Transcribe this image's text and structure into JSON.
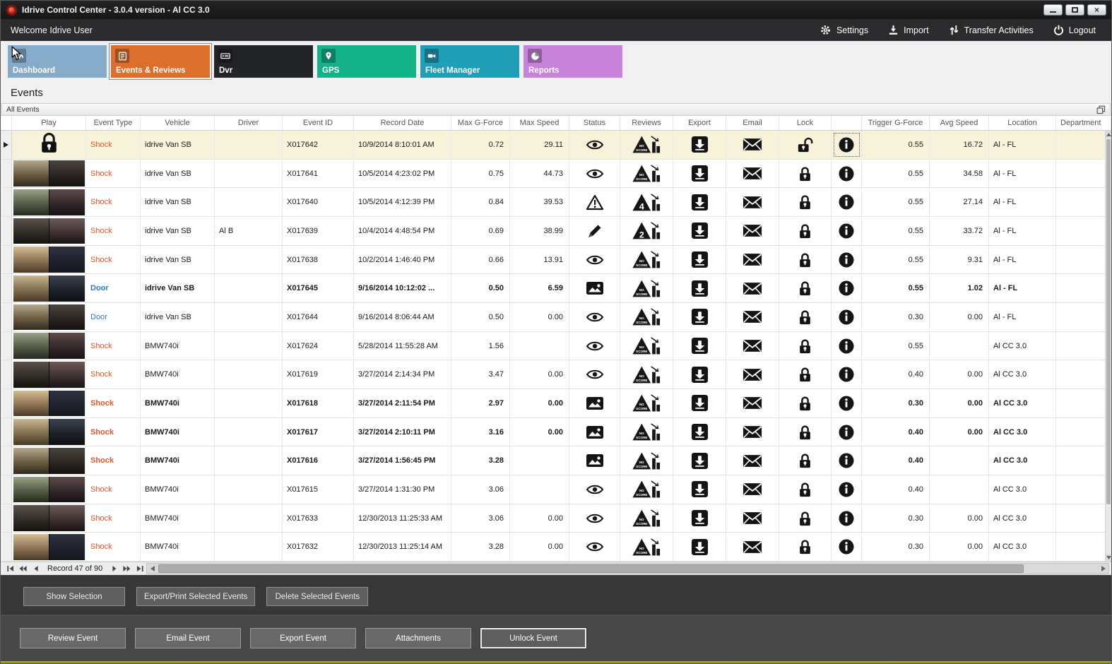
{
  "window": {
    "title": "Idrive Control Center - 3.0.4 version - Al CC 3.0"
  },
  "toolbar": {
    "welcome": "Welcome Idrive User",
    "actions": [
      {
        "label": "Settings",
        "icon": "gear-icon"
      },
      {
        "label": "Import",
        "icon": "import-icon"
      },
      {
        "label": "Transfer Activities",
        "icon": "transfer-icon"
      },
      {
        "label": "Logout",
        "icon": "power-icon"
      }
    ]
  },
  "nav_tiles": [
    {
      "label": "Dashboard",
      "icon": "dashboard-icon",
      "color": "#86abc9",
      "selected": false
    },
    {
      "label": "Events & Reviews",
      "icon": "events-icon",
      "color": "#dd6f2d",
      "selected": true
    },
    {
      "label": "Dvr",
      "icon": "dvr-icon",
      "color": "#232427",
      "selected": false
    },
    {
      "label": "GPS",
      "icon": "gps-icon",
      "color": "#15b189",
      "selected": false
    },
    {
      "label": "Fleet Manager",
      "icon": "fleet-manager-icon",
      "color": "#1f9eb5",
      "selected": false
    },
    {
      "label": "Reports",
      "icon": "reports-icon",
      "color": "#c783da",
      "selected": false
    }
  ],
  "page_title": "Events",
  "group_label": "All Events",
  "table": {
    "columns": [
      "Play",
      "Event Type",
      "Vehicle",
      "Driver",
      "Event ID",
      "Record Date",
      "Max G-Force",
      "Max Speed",
      "Status",
      "Reviews",
      "Export",
      "Email",
      "Lock",
      "",
      "Trigger G-Force",
      "Avg Speed",
      "Location",
      "Department"
    ],
    "rows": [
      {
        "selected": true,
        "bold": false,
        "play": "lock",
        "type": "Shock",
        "vehicle": "idrive Van SB",
        "driver": "",
        "id": "X017642",
        "date": "10/9/2014 8:10:01 AM",
        "max_g": "0.72",
        "max_speed": "29.11",
        "status": "eye",
        "review": "NO SCORE",
        "lock": "unlocked",
        "trigger_g": "0.55",
        "avg_speed": "16.72",
        "location": "Al - FL"
      },
      {
        "selected": false,
        "bold": false,
        "play": "thumb",
        "type": "Shock",
        "vehicle": "idrive Van SB",
        "driver": "",
        "id": "X017641",
        "date": "10/5/2014 4:23:02 PM",
        "max_g": "0.75",
        "max_speed": "44.73",
        "status": "eye",
        "review": "NO SCORE",
        "lock": "locked",
        "trigger_g": "0.55",
        "avg_speed": "34.58",
        "location": "Al - FL"
      },
      {
        "selected": false,
        "bold": false,
        "play": "thumb",
        "type": "Shock",
        "vehicle": "idrive Van SB",
        "driver": "",
        "id": "X017640",
        "date": "10/5/2014 4:12:39 PM",
        "max_g": "0.84",
        "max_speed": "39.53",
        "status": "warning",
        "review": "4",
        "lock": "locked",
        "trigger_g": "0.55",
        "avg_speed": "27.14",
        "location": "Al - FL"
      },
      {
        "selected": false,
        "bold": false,
        "play": "thumb",
        "type": "Shock",
        "vehicle": "idrive Van SB",
        "driver": "Al B",
        "id": "X017639",
        "date": "10/4/2014 4:48:54 PM",
        "max_g": "0.69",
        "max_speed": "38.99",
        "status": "pencil",
        "review": "2",
        "lock": "locked",
        "trigger_g": "0.55",
        "avg_speed": "33.72",
        "location": "Al - FL"
      },
      {
        "selected": false,
        "bold": false,
        "play": "thumb",
        "type": "Shock",
        "vehicle": "idrive Van SB",
        "driver": "",
        "id": "X017638",
        "date": "10/2/2014 1:46:40 PM",
        "max_g": "0.66",
        "max_speed": "13.91",
        "status": "eye",
        "review": "NO SCORE",
        "lock": "locked",
        "trigger_g": "0.55",
        "avg_speed": "9.31",
        "location": "Al - FL"
      },
      {
        "selected": false,
        "bold": true,
        "play": "thumb",
        "type": "Door",
        "vehicle": "idrive Van SB",
        "driver": "",
        "id": "X017645",
        "date": "9/16/2014 10:12:02 ...",
        "max_g": "0.50",
        "max_speed": "6.59",
        "status": "image",
        "review": "NO SCORE",
        "lock": "locked",
        "trigger_g": "0.55",
        "avg_speed": "1.02",
        "location": "Al - FL"
      },
      {
        "selected": false,
        "bold": false,
        "play": "thumb",
        "type": "Door",
        "vehicle": "idrive Van SB",
        "driver": "",
        "id": "X017644",
        "date": "9/16/2014 8:06:44 AM",
        "max_g": "0.50",
        "max_speed": "0.00",
        "status": "eye",
        "review": "NO SCORE",
        "lock": "locked",
        "trigger_g": "0.30",
        "avg_speed": "0.00",
        "location": "Al - FL"
      },
      {
        "selected": false,
        "bold": false,
        "play": "thumb",
        "type": "Shock",
        "vehicle": "BMW740i",
        "driver": "",
        "id": "X017624",
        "date": "5/28/2014 11:55:28 AM",
        "max_g": "1.56",
        "max_speed": "",
        "status": "eye",
        "review": "NO SCORE",
        "lock": "locked",
        "trigger_g": "0.55",
        "avg_speed": "",
        "location": "Al CC 3.0"
      },
      {
        "selected": false,
        "bold": false,
        "play": "thumb",
        "type": "Shock",
        "vehicle": "BMW740i",
        "driver": "",
        "id": "X017619",
        "date": "3/27/2014 2:14:34 PM",
        "max_g": "3.47",
        "max_speed": "0.00",
        "status": "eye",
        "review": "NO SCORE",
        "lock": "locked",
        "trigger_g": "0.40",
        "avg_speed": "0.00",
        "location": "Al CC 3.0"
      },
      {
        "selected": false,
        "bold": true,
        "play": "thumb",
        "type": "Shock",
        "vehicle": "BMW740i",
        "driver": "",
        "id": "X017618",
        "date": "3/27/2014 2:11:54 PM",
        "max_g": "2.97",
        "max_speed": "0.00",
        "status": "image",
        "review": "NO SCORE",
        "lock": "locked",
        "trigger_g": "0.30",
        "avg_speed": "0.00",
        "location": "Al CC 3.0"
      },
      {
        "selected": false,
        "bold": true,
        "play": "thumb",
        "type": "Shock",
        "vehicle": "BMW740i",
        "driver": "",
        "id": "X017617",
        "date": "3/27/2014 2:10:11 PM",
        "max_g": "3.16",
        "max_speed": "0.00",
        "status": "image",
        "review": "NO SCORE",
        "lock": "locked",
        "trigger_g": "0.40",
        "avg_speed": "0.00",
        "location": "Al CC 3.0"
      },
      {
        "selected": false,
        "bold": true,
        "play": "thumb",
        "type": "Shock",
        "vehicle": "BMW740i",
        "driver": "",
        "id": "X017616",
        "date": "3/27/2014 1:56:45 PM",
        "max_g": "3.28",
        "max_speed": "",
        "status": "image",
        "review": "NO SCORE",
        "lock": "locked",
        "trigger_g": "0.40",
        "avg_speed": "",
        "location": "Al CC 3.0"
      },
      {
        "selected": false,
        "bold": false,
        "play": "thumb",
        "type": "Shock",
        "vehicle": "BMW740i",
        "driver": "",
        "id": "X017615",
        "date": "3/27/2014 1:31:30 PM",
        "max_g": "3.06",
        "max_speed": "",
        "status": "eye",
        "review": "NO SCORE",
        "lock": "locked",
        "trigger_g": "0.40",
        "avg_speed": "",
        "location": "Al CC 3.0"
      },
      {
        "selected": false,
        "bold": false,
        "play": "thumb",
        "type": "Shock",
        "vehicle": "BMW740i",
        "driver": "",
        "id": "X017633",
        "date": "12/30/2013 11:25:33 AM",
        "max_g": "3.06",
        "max_speed": "0.00",
        "status": "eye",
        "review": "NO SCORE",
        "lock": "locked",
        "trigger_g": "0.30",
        "avg_speed": "0.00",
        "location": "Al CC 3.0"
      },
      {
        "selected": false,
        "bold": false,
        "play": "thumb",
        "type": "Shock",
        "vehicle": "BMW740i",
        "driver": "",
        "id": "X017632",
        "date": "12/30/2013 11:25:14 AM",
        "max_g": "3.28",
        "max_speed": "0.00",
        "status": "eye",
        "review": "NO SCORE",
        "lock": "locked",
        "trigger_g": "0.30",
        "avg_speed": "0.00",
        "location": "Al CC 3.0"
      }
    ]
  },
  "record_nav": {
    "label": "Record 47 of 90"
  },
  "selection_buttons": [
    "Show Selection",
    "Export/Print Selected Events",
    "Delete Selected  Events"
  ],
  "event_buttons": [
    {
      "label": "Review Event",
      "focused": false
    },
    {
      "label": "Email Event",
      "focused": false
    },
    {
      "label": "Export Event",
      "focused": false
    },
    {
      "label": "Attachments",
      "focused": false
    },
    {
      "label": "Unlock Event",
      "focused": true
    }
  ],
  "colors": {
    "shock": "#e2572b",
    "door": "#2e7bbf",
    "selected_row": "#f7f3da",
    "accent_strip": "#9b9a33"
  }
}
